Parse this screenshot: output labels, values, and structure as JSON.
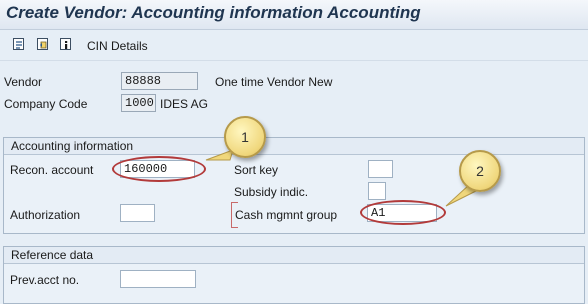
{
  "title": "Create Vendor: Accounting information Accounting",
  "toolbar": {
    "icons": [
      "toggle-icon",
      "document-icon",
      "info-icon"
    ],
    "cin_details": "CIN Details"
  },
  "header": {
    "vendor_label": "Vendor",
    "vendor_value": "88888",
    "vendor_name": "One time Vendor New",
    "company_code_label": "Company Code",
    "company_code_value": "1000",
    "company_name": "IDES AG"
  },
  "accounting_info": {
    "group_title": "Accounting information",
    "recon_account_label": "Recon. account",
    "recon_account_value": "160000",
    "sort_key_label": "Sort key",
    "sort_key_value": "",
    "subsidy_indic_label": "Subsidy indic.",
    "subsidy_indic_value": "",
    "authorization_label": "Authorization",
    "authorization_value": "",
    "cash_mgmt_label": "Cash mgmnt group",
    "cash_mgmt_value": "A1"
  },
  "reference_data": {
    "group_title": "Reference data",
    "prev_acct_label": "Prev.acct no.",
    "prev_acct_value": ""
  },
  "callouts": {
    "one": "1",
    "two": "2"
  },
  "colors": {
    "background": "#e6eef6",
    "title_text": "#1f3550",
    "highlight_oval": "#b23a3a",
    "callout_fill": "#f0d77c"
  }
}
